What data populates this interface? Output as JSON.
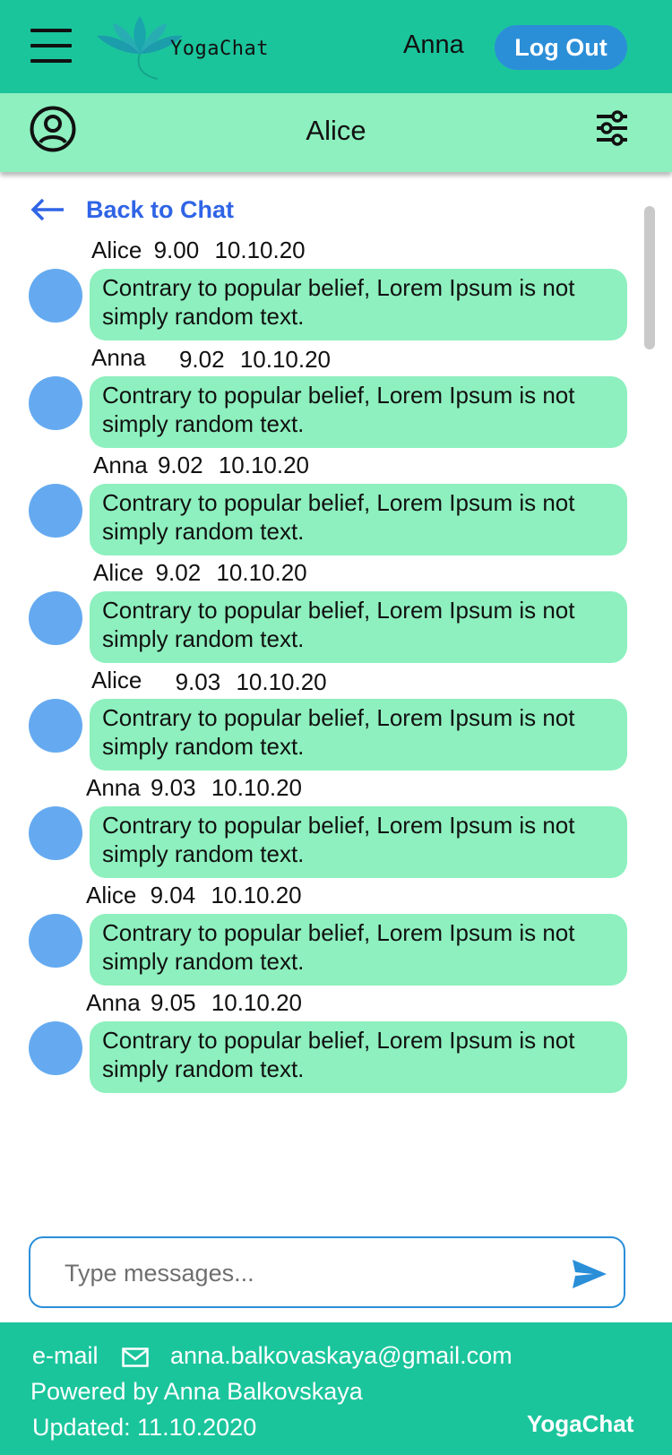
{
  "app": {
    "brand_name": "YogaChat",
    "current_user": "Anna",
    "logout_label": "Log Out",
    "accent_color": "#1bc59c",
    "bubble_color": "#8df0be",
    "button_color": "#2b8fd8",
    "link_color": "#2f64e6",
    "avatar_color": "#65aaf0"
  },
  "chat": {
    "title": "Alice",
    "back_label": "Back to Chat"
  },
  "messages": [
    {
      "sender": "Alice",
      "time": "9.00",
      "date": "10.10.20",
      "text": "Contrary to popular belief, Lorem Ipsum is not simply random text."
    },
    {
      "sender": "Anna",
      "time": "9.02",
      "date": "10.10.20",
      "text": "Contrary to popular belief, Lorem Ipsum is not simply random text."
    },
    {
      "sender": "Anna",
      "time": "9.02",
      "date": "10.10.20",
      "text": "Contrary to popular belief, Lorem Ipsum is not simply random text."
    },
    {
      "sender": "Alice",
      "time": "9.02",
      "date": "10.10.20",
      "text": "Contrary to popular belief, Lorem Ipsum is not simply random text."
    },
    {
      "sender": "Alice",
      "time": "9.03",
      "date": "10.10.20",
      "text": "Contrary to popular belief, Lorem Ipsum is not simply random text."
    },
    {
      "sender": "Anna",
      "time": "9.03",
      "date": "10.10.20",
      "text": "Contrary to popular belief, Lorem Ipsum is not simply random text."
    },
    {
      "sender": "Alice",
      "time": "9.04",
      "date": "10.10.20",
      "text": "Contrary to popular belief, Lorem Ipsum is not simply random text."
    },
    {
      "sender": "Anna",
      "time": "9.05",
      "date": "10.10.20",
      "text": "Contrary to popular belief, Lorem Ipsum is not simply random text."
    }
  ],
  "composer": {
    "placeholder": "Type messages..."
  },
  "footer": {
    "email_label": "e-mail",
    "email": "anna.balkovaskaya@gmail.com",
    "powered_by": "Powered by Anna Balkovskaya",
    "updated": "Updated: 11.10.2020",
    "brand": "YogaChat"
  },
  "icons": [
    "menu-icon",
    "lotus-logo-icon",
    "user-circle-icon",
    "sliders-icon",
    "arrow-left-icon",
    "send-icon",
    "mail-icon"
  ]
}
